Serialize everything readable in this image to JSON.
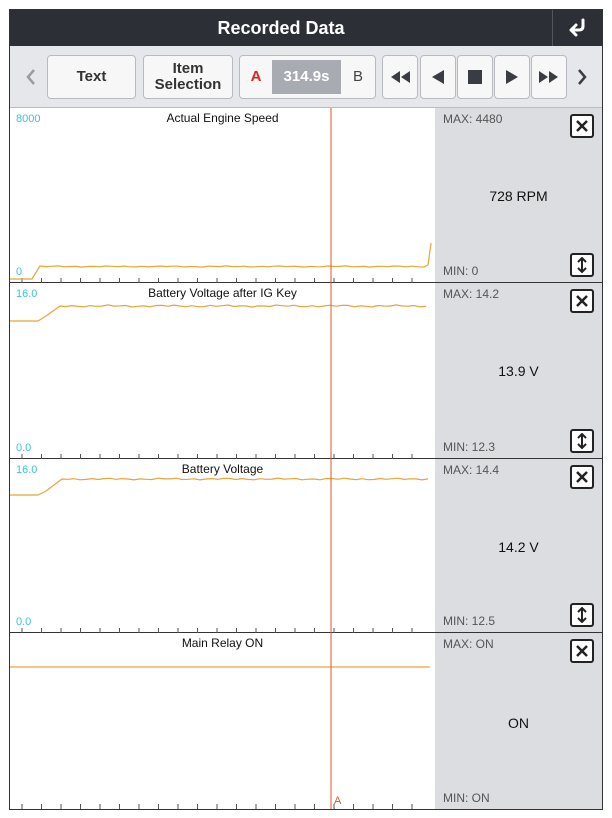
{
  "header": {
    "title": "Recorded Data"
  },
  "toolbar": {
    "text_label": "Text",
    "item_selection_label": "Item Selection",
    "marker_a": "A",
    "time": "314.9s",
    "marker_b": "B"
  },
  "cursor_label": "A",
  "colors": {
    "trace": "#e8a33a",
    "cursor": "#e0572d",
    "axis_label": "#3cc4d4"
  },
  "panels": [
    {
      "title": "Actual Engine Speed",
      "ymax": "8000",
      "ymin": "0",
      "max": "MAX: 4480",
      "min": "MIN: 0",
      "value": "728 RPM",
      "has_scale": true
    },
    {
      "title": "Battery Voltage after IG Key",
      "ymax": "16.0",
      "ymin": "0.0",
      "max": "MAX: 14.2",
      "min": "MIN: 12.3",
      "value": "13.9 V",
      "has_scale": true
    },
    {
      "title": "Battery Voltage",
      "ymax": "16.0",
      "ymin": "0.0",
      "max": "MAX: 14.4",
      "min": "MIN: 12.5",
      "value": "14.2 V",
      "has_scale": true
    },
    {
      "title": "Main Relay ON",
      "ymax": "",
      "ymin": "",
      "max": "MAX: ON",
      "min": "MIN: ON",
      "value": "ON",
      "has_scale": false
    }
  ]
}
